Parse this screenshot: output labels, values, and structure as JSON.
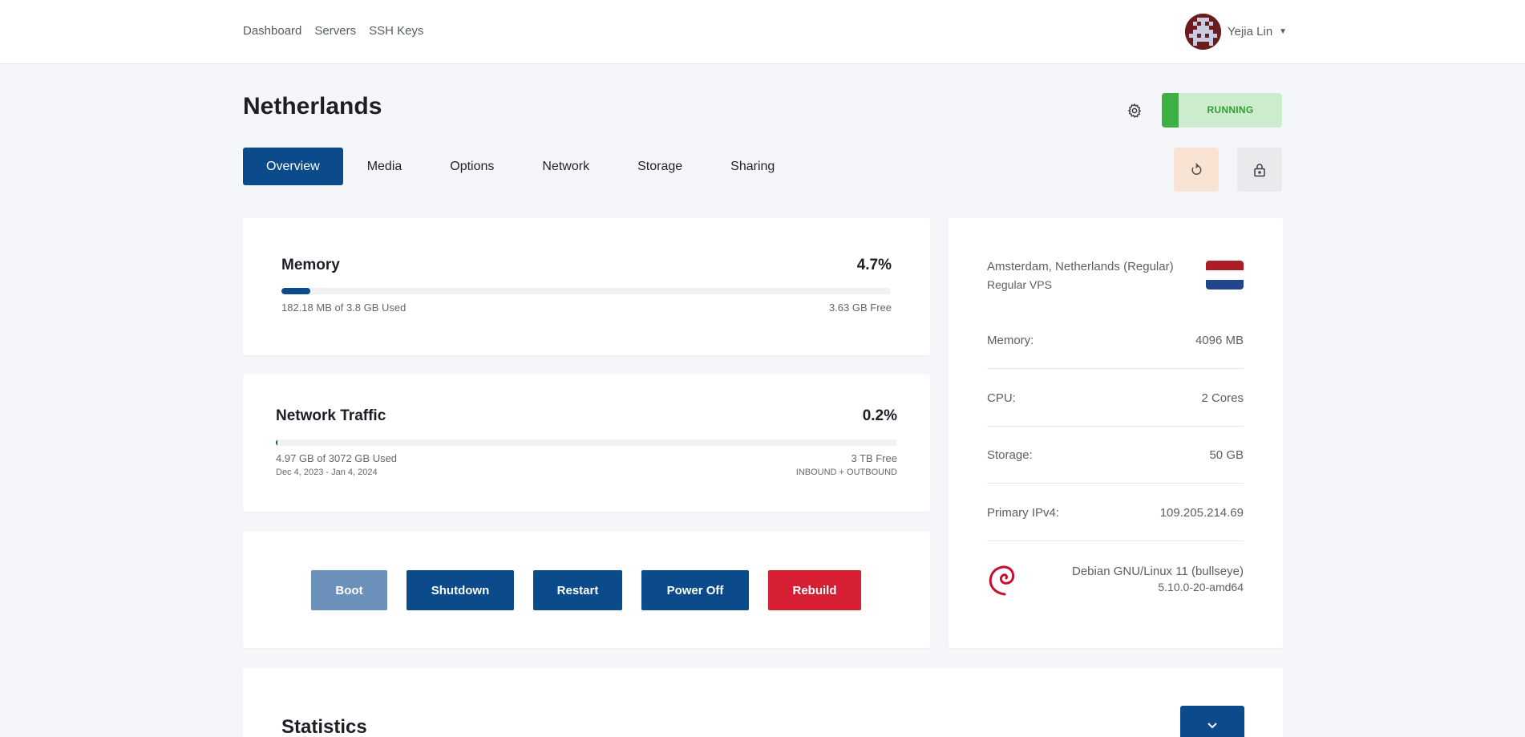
{
  "nav": {
    "links": [
      "Dashboard",
      "Servers",
      "SSH Keys"
    ],
    "user_name": "Yejia Lin"
  },
  "server": {
    "name": "Netherlands",
    "status": "RUNNING"
  },
  "tabs": [
    "Overview",
    "Media",
    "Options",
    "Network",
    "Storage",
    "Sharing"
  ],
  "active_tab": "Overview",
  "memory": {
    "title": "Memory",
    "percent_label": "4.7%",
    "percent": 4.7,
    "used_label": "182.18 MB of 3.8 GB Used",
    "free_label": "3.63 GB Free"
  },
  "network": {
    "title": "Network Traffic",
    "percent_label": "0.2%",
    "percent": 0.2,
    "used_label": "4.97 GB of 3072 GB Used",
    "period_label": "Dec 4, 2023 - Jan 4, 2024",
    "free_label": "3 TB Free",
    "direction_label": "INBOUND + OUTBOUND"
  },
  "actions": {
    "boot": "Boot",
    "shutdown": "Shutdown",
    "restart": "Restart",
    "power_off": "Power Off",
    "rebuild": "Rebuild"
  },
  "info": {
    "location": "Amsterdam, Netherlands (Regular)",
    "plan": "Regular VPS",
    "specs": [
      {
        "label": "Memory:",
        "value": "4096 MB"
      },
      {
        "label": "CPU:",
        "value": "2 Cores"
      },
      {
        "label": "Storage:",
        "value": "50 GB"
      },
      {
        "label": "Primary IPv4:",
        "value": "109.205.214.69"
      }
    ],
    "os_name": "Debian GNU/Linux 11 (bullseye)",
    "os_kernel": "5.10.0-20-amd64"
  },
  "statistics": {
    "title": "Statistics"
  },
  "colors": {
    "primary": "#0b4a8b",
    "danger": "#d61f32",
    "running": "#3cb043",
    "running_bg": "#cdeccd"
  }
}
